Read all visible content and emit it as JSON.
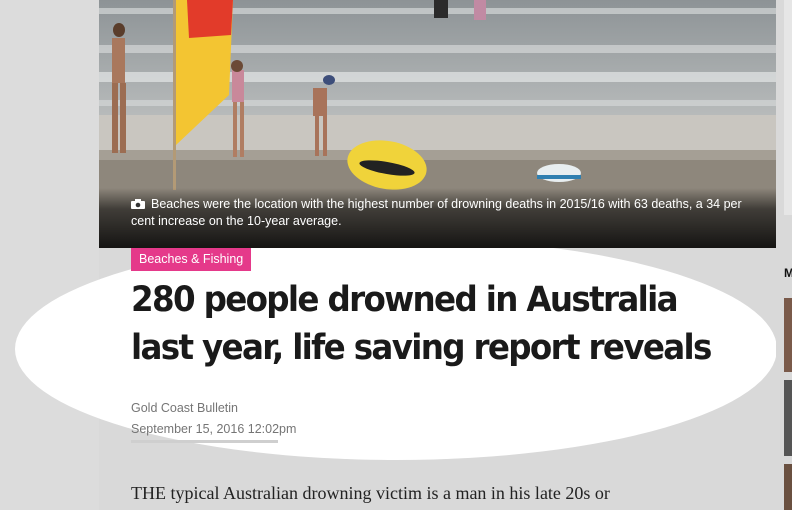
{
  "hero": {
    "caption": "Beaches were the location with the highest number of drowning deaths in 2015/16 with 63 deaths, a 34 per cent increase on the 10-year average.",
    "icon": "camera-icon"
  },
  "article": {
    "tag": "Beaches & Fishing",
    "headline": "280 people drowned in Australia last year, life saving report reveals",
    "source": "Gold Coast Bulletin",
    "date": "September 15, 2016 12:02pm",
    "lead": "THE typical Australian drowning victim is a man in his late 20s or"
  },
  "right_rail": {
    "letter": "M"
  },
  "colors": {
    "tag_bg": "#e5398a",
    "headline": "#1a1a1a",
    "meta": "#757575"
  }
}
